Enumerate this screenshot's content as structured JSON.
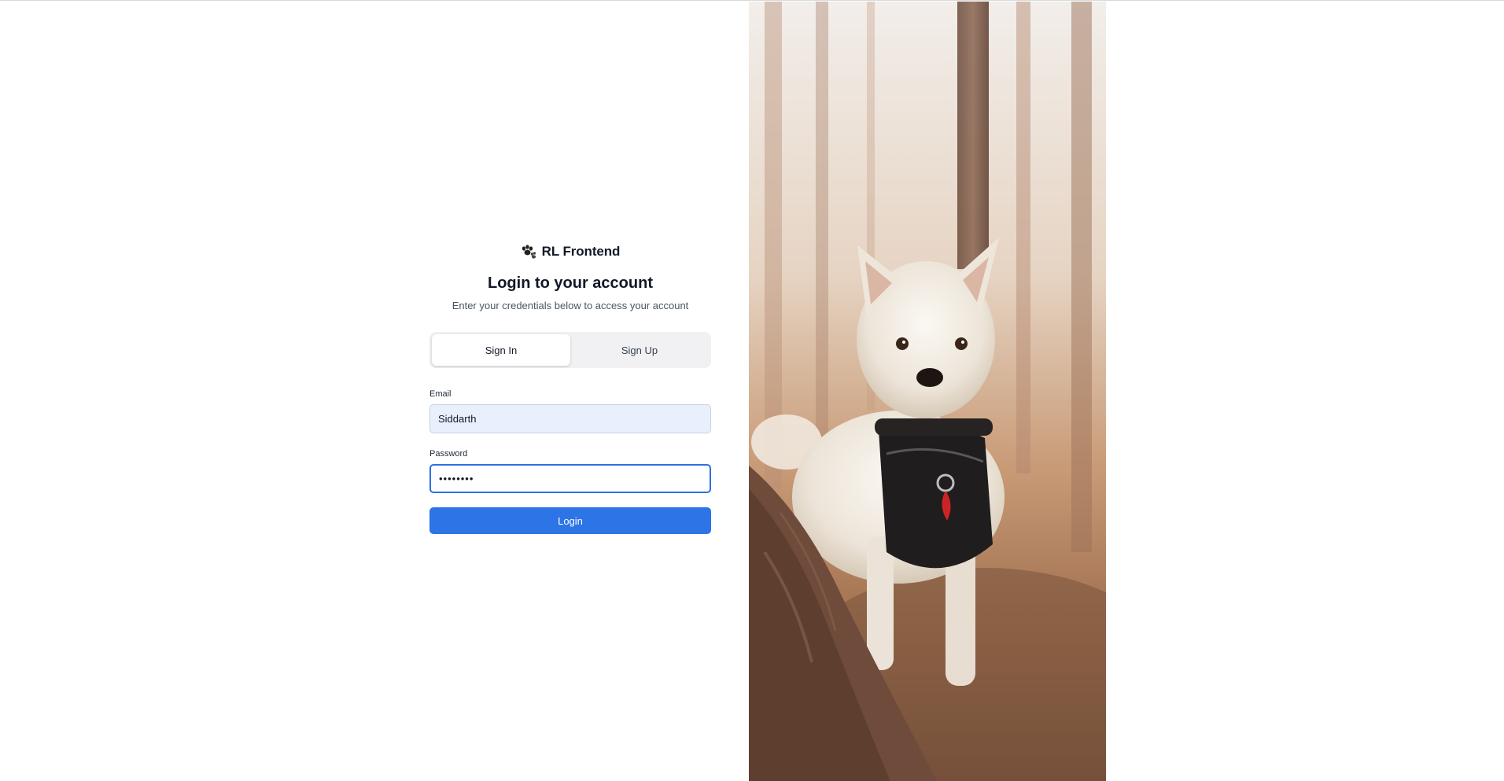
{
  "brand": {
    "name": "RL Frontend",
    "icon": "paw-icon"
  },
  "login": {
    "title": "Login to your account",
    "subtitle": "Enter your credentials below to access your account"
  },
  "tabs": [
    {
      "label": "Sign In",
      "active": true
    },
    {
      "label": "Sign Up",
      "active": false
    }
  ],
  "form": {
    "email_label": "Email",
    "email_value": "Siddarth",
    "password_label": "Password",
    "password_value": "password",
    "submit_label": "Login"
  },
  "colors": {
    "primary": "#2d74e6",
    "focus_ring": "#2f6fdf",
    "autofill_bg": "#e8f0fe",
    "tab_track": "#f1f1f3"
  }
}
